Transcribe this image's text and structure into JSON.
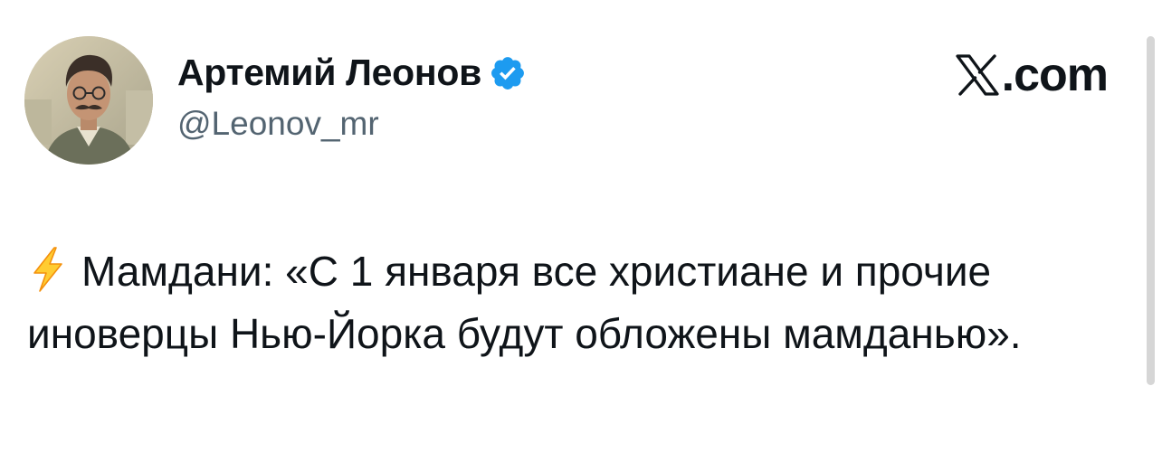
{
  "author": {
    "display_name": "Артемий Леонов",
    "handle": "@Leonov_mr",
    "verified": true,
    "avatar_icon": "profile-photo"
  },
  "brand": {
    "logo_icon": "x-logo-icon",
    "text": ".com"
  },
  "tweet": {
    "emoji_icon": "high-voltage-icon",
    "text": "Мамдани: «С 1 января все христиане и прочие иноверцы Нью-Йорка будут обложены мамданью»."
  },
  "colors": {
    "text": "#0f1419",
    "secondary": "#536471",
    "verified": "#1d9bf0",
    "bolt": "#ffcc32"
  }
}
